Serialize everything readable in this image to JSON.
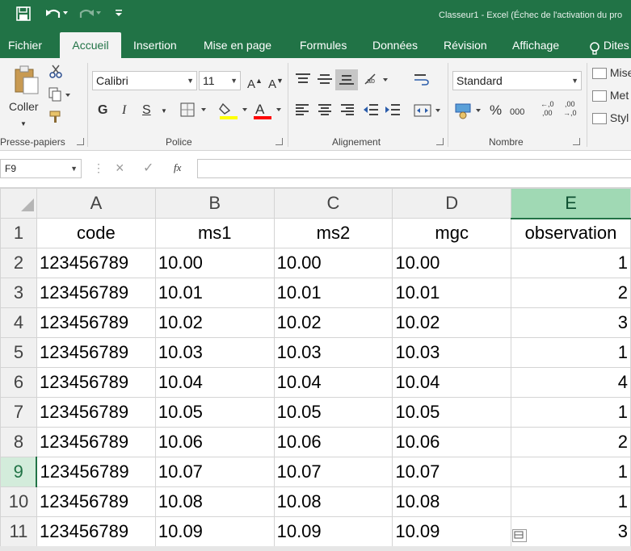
{
  "window": {
    "title": "Classeur1 - Excel (Échec de l'activation du pro"
  },
  "tabs": [
    {
      "label": "Fichier"
    },
    {
      "label": "Accueil"
    },
    {
      "label": "Insertion"
    },
    {
      "label": "Mise en page"
    },
    {
      "label": "Formules"
    },
    {
      "label": "Données"
    },
    {
      "label": "Révision"
    },
    {
      "label": "Affichage"
    },
    {
      "label": "Dites"
    }
  ],
  "ribbon": {
    "clipboard": {
      "paste_label": "Coller",
      "group_label": "Presse-papiers"
    },
    "font": {
      "font_name": "Calibri",
      "font_size": "11",
      "bold": "G",
      "italic": "I",
      "underline": "S",
      "group_label": "Police",
      "highlight_color": "#ffff00",
      "font_color": "#ff0000"
    },
    "alignment": {
      "group_label": "Alignement"
    },
    "number": {
      "format": "Standard",
      "percent": "%",
      "thousands": "000",
      "dec_inc": "←,0\n,00",
      "dec_dec": ",00\n→,0",
      "group_label": "Nombre"
    },
    "styles": {
      "item1": "Mise",
      "item2": "Met",
      "item3": "Styl"
    }
  },
  "formula_bar": {
    "name_box": "F9",
    "cancel": "×",
    "enter": "✓",
    "fx": "fx",
    "value": ""
  },
  "columns": [
    "A",
    "B",
    "C",
    "D",
    "E"
  ],
  "selected_column": "E",
  "selected_row": "9",
  "header_row": [
    "code",
    "ms1",
    "ms2",
    "mgc",
    "observation"
  ],
  "rows": [
    {
      "num": "2",
      "cells": [
        "123456789",
        "10.00",
        "10.00",
        "10.00",
        "1"
      ]
    },
    {
      "num": "3",
      "cells": [
        "123456789",
        "10.01",
        "10.01",
        "10.01",
        "2"
      ]
    },
    {
      "num": "4",
      "cells": [
        "123456789",
        "10.02",
        "10.02",
        "10.02",
        "3"
      ]
    },
    {
      "num": "5",
      "cells": [
        "123456789",
        "10.03",
        "10.03",
        "10.03",
        "1"
      ]
    },
    {
      "num": "6",
      "cells": [
        "123456789",
        "10.04",
        "10.04",
        "10.04",
        "4"
      ]
    },
    {
      "num": "7",
      "cells": [
        "123456789",
        "10.05",
        "10.05",
        "10.05",
        "1"
      ]
    },
    {
      "num": "8",
      "cells": [
        "123456789",
        "10.06",
        "10.06",
        "10.06",
        "2"
      ]
    },
    {
      "num": "9",
      "cells": [
        "123456789",
        "10.07",
        "10.07",
        "10.07",
        "1"
      ]
    },
    {
      "num": "10",
      "cells": [
        "123456789",
        "10.08",
        "10.08",
        "10.08",
        "1"
      ]
    },
    {
      "num": "11",
      "cells": [
        "123456789",
        "10.09",
        "10.09",
        "10.09",
        "3"
      ]
    }
  ],
  "header_row_num": "1",
  "theme": {
    "accent": "#217346",
    "selected_header": "#a0d9b4"
  }
}
